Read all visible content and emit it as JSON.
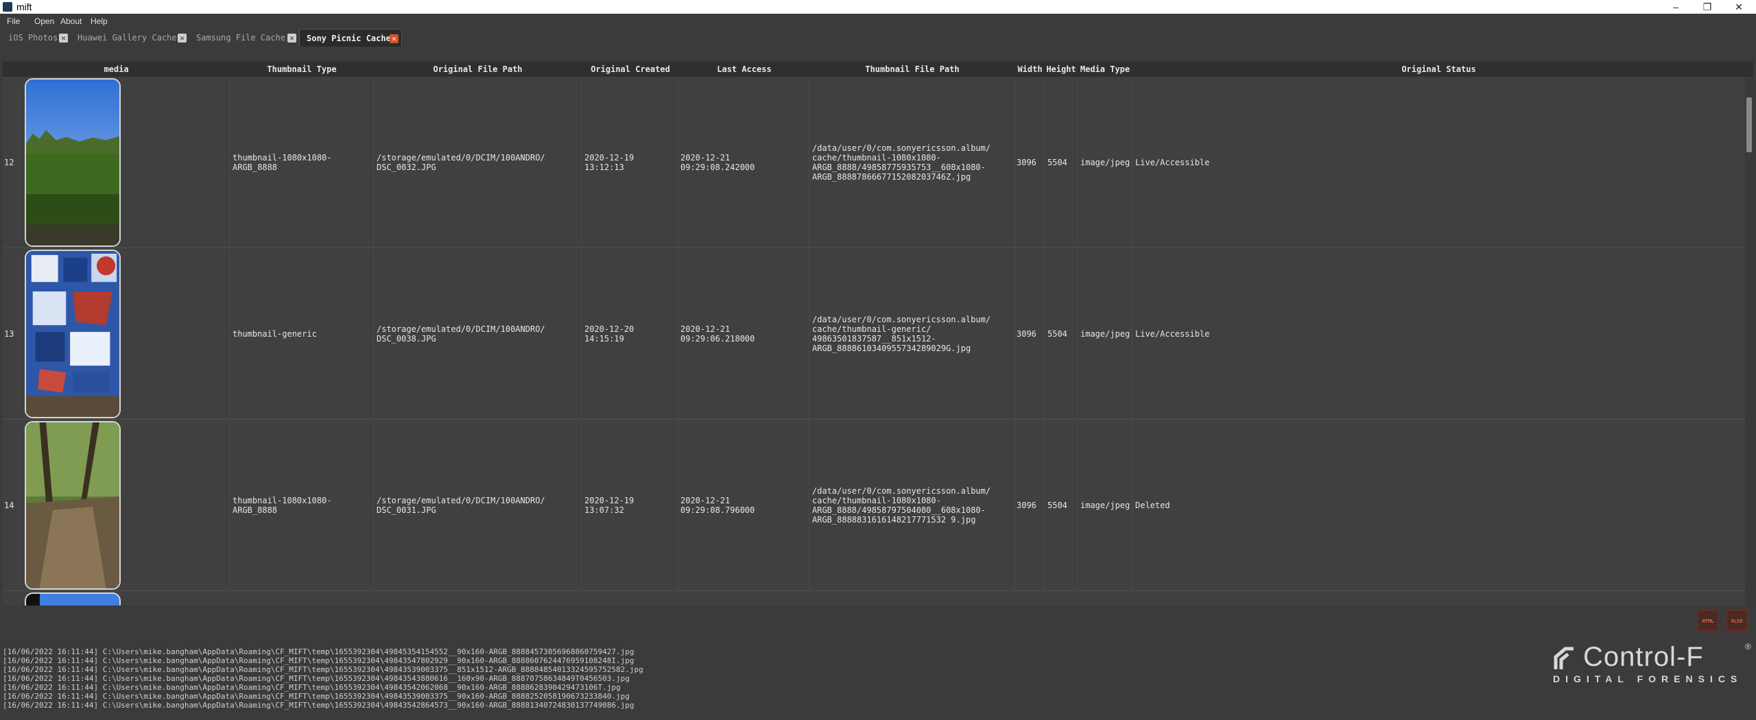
{
  "window": {
    "title": "mift",
    "min": "–",
    "restore": "❐",
    "close": "✕"
  },
  "menu": [
    "File",
    "Open",
    "About",
    "Help"
  ],
  "tabs": [
    {
      "label": "iOS Photos",
      "active": false
    },
    {
      "label": "Huawei Gallery Cache",
      "active": false
    },
    {
      "label": "Samsung File Cache",
      "active": false
    },
    {
      "label": "Sony Picnic Cache",
      "active": true
    }
  ],
  "table": {
    "columns": [
      "media",
      "Thumbnail Type",
      "Original File Path",
      "Original Created",
      "Last Access",
      "Thumbnail File Path",
      "Width",
      "Height",
      "Media Type",
      "Original Status"
    ],
    "rows": [
      {
        "index": "12",
        "thumbnail_type": "thumbnail-1080x1080-ARGB_8888",
        "original_path": "/storage/emulated/0/DCIM/100ANDRO/\nDSC_0032.JPG",
        "original_created": "2020-12-19 13:12:13",
        "last_access": "2020-12-21 09:29:08.242000",
        "thumbnail_path": "/data/user/0/com.sonyericsson.album/\ncache/thumbnail-1080x1080-\nARGB_8888/49858775935753__608x1080-\nARGB_8888786667715208203746Z.jpg",
        "width": "3096",
        "height": "5504",
        "media_type": "image/jpeg",
        "status": "Live/Accessible"
      },
      {
        "index": "13",
        "thumbnail_type": "thumbnail-generic",
        "original_path": "/storage/emulated/0/DCIM/100ANDRO/\nDSC_0038.JPG",
        "original_created": "2020-12-20 14:15:19",
        "last_access": "2020-12-21 09:29:06.218000",
        "thumbnail_path": "/data/user/0/com.sonyericsson.album/\ncache/thumbnail-generic/\n49863501837587__851x1512-\nARGB_8888610340955734289029G.jpg",
        "width": "3096",
        "height": "5504",
        "media_type": "image/jpeg",
        "status": "Live/Accessible"
      },
      {
        "index": "14",
        "thumbnail_type": "thumbnail-1080x1080-ARGB_8888",
        "original_path": "/storage/emulated/0/DCIM/100ANDRO/\nDSC_0031.JPG",
        "original_created": "2020-12-19 13:07:32",
        "last_access": "2020-12-21 09:29:08.796000",
        "thumbnail_path": "/data/user/0/com.sonyericsson.album/\ncache/thumbnail-1080x1080-\nARGB_8888/49858797504080__608x1080-\nARGB_8888831616148217771532 9.jpg",
        "width": "3096",
        "height": "5504",
        "media_type": "image/jpeg",
        "status": "Deleted"
      }
    ]
  },
  "log": [
    "[16/06/2022 16:11:44] C:\\Users\\mike.bangham\\AppData\\Roaming\\CF_MIFT\\temp\\1655392304\\49845354154552__90x160-ARGB_88884573056968860759427.jpg",
    "[16/06/2022 16:11:44] C:\\Users\\mike.bangham\\AppData\\Roaming\\CF_MIFT\\temp\\1655392304\\49843547802929__90x160-ARGB_8888607624476959108248I.jpg",
    "[16/06/2022 16:11:44] C:\\Users\\mike.bangham\\AppData\\Roaming\\CF_MIFT\\temp\\1655392304\\49843539003375__851x1512-ARGB_88884854013324595752582.jpg",
    "[16/06/2022 16:11:44] C:\\Users\\mike.bangham\\AppData\\Roaming\\CF_MIFT\\temp\\1655392304\\49843543880616__160x90-ARGB_88870758634849T0456503.jpg",
    "[16/06/2022 16:11:44] C:\\Users\\mike.bangham\\AppData\\Roaming\\CF_MIFT\\temp\\1655392304\\49843542062068__90x160-ARGB_8888628390429473106T.jpg",
    "[16/06/2022 16:11:44] C:\\Users\\mike.bangham\\AppData\\Roaming\\CF_MIFT\\temp\\1655392304\\49843539003375__90x160-ARGB_8888252058190673233840.jpg",
    "[16/06/2022 16:11:44] C:\\Users\\mike.bangham\\AppData\\Roaming\\CF_MIFT\\temp\\1655392304\\49843542864573__90x160-ARGB_88881340724830137749086.jpg"
  ],
  "export": {
    "html": "HTML",
    "xlsx": "XLSX"
  },
  "logo": {
    "brand": "Control-F",
    "reg": "®",
    "sub": "DIGITAL FORENSICS"
  },
  "colors": {
    "accent": "#d3532b",
    "background": "#3b3b3b",
    "table": "#404040"
  }
}
